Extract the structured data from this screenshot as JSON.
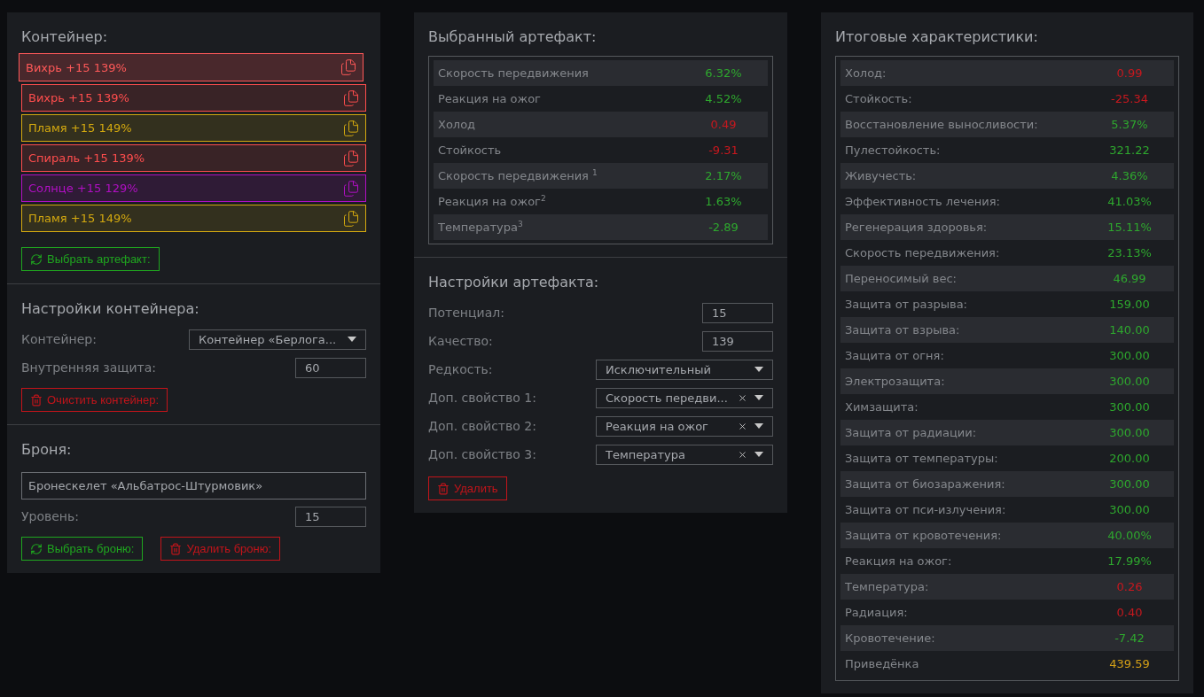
{
  "container": {
    "title": "Контейнер:",
    "slots": [
      {
        "label": "Вихрь +15 139%",
        "color": "#ff4d4d",
        "selected": true
      },
      {
        "label": "Вихрь +15 139%",
        "color": "#ff4d4d",
        "selected": false
      },
      {
        "label": "Пламя +15 149%",
        "color": "#d4a90f",
        "selected": false
      },
      {
        "label": "Спираль +15 139%",
        "color": "#ff4d4d",
        "selected": false
      },
      {
        "label": "Солнце +15 129%",
        "color": "#b10fc4",
        "selected": false
      },
      {
        "label": "Пламя +15 149%",
        "color": "#d4a90f",
        "selected": false
      }
    ],
    "buttons": [
      {
        "kind": "select",
        "label": "Выбрать артефакт:"
      }
    ]
  },
  "container_settings": {
    "title": "Настройки контейнера:",
    "fields": [
      {
        "kind": "select",
        "label": "Контейнер:",
        "value": "Контейнер «Берлога..."
      },
      {
        "kind": "input",
        "label": "Внутренняя защита:",
        "value": "60"
      }
    ],
    "buttons": [
      {
        "kind": "delete",
        "label": "Очистить контейнер:"
      }
    ]
  },
  "armor": {
    "title": "Броня:",
    "name": "Бронескелет «Альбатрос-Штурмовик»",
    "fields": [
      {
        "kind": "input",
        "label": "Уровень:",
        "value": "15"
      }
    ],
    "buttons": [
      {
        "kind": "select",
        "label": "Выбрать броню:"
      },
      {
        "kind": "delete",
        "label": "Удалить броню:"
      }
    ]
  },
  "selected_artifact": {
    "title": "Выбранный артефакт:",
    "stats": [
      {
        "name": "Скорость передвижения",
        "value": "6.32%",
        "color": "#2ea82e"
      },
      {
        "name": "Реакция на ожог",
        "value": "4.52%",
        "color": "#2ea82e"
      },
      {
        "name": "Холод",
        "value": "0.49",
        "color": "#c8181e"
      },
      {
        "name": "Стойкость",
        "value": "-9.31",
        "color": "#c8181e"
      },
      {
        "name": "Скорость передвижения $^{1}$",
        "value": "2.17%",
        "color": "#2ea82e"
      },
      {
        "name": "Реакция на ожог$^{2}$",
        "value": "1.63%",
        "color": "#2ea82e"
      },
      {
        "name": "Температура$^{3}$",
        "value": "-2.89",
        "color": "#2ea82e"
      }
    ]
  },
  "artifact_settings": {
    "title": "Настройки артефакта:",
    "fields": [
      {
        "kind": "input",
        "label": "Потенциал:",
        "value": "15"
      },
      {
        "kind": "input",
        "label": "Качество:",
        "value": "139"
      },
      {
        "kind": "select",
        "label": "Редкость:",
        "value": "Исключительный"
      },
      {
        "kind": "clearable",
        "label": "Доп. свойство 1:",
        "value": "Скорость передви..."
      },
      {
        "kind": "clearable",
        "label": "Доп. свойство 2:",
        "value": "Реакция на ожог"
      },
      {
        "kind": "clearable",
        "label": "Доп. свойство 3:",
        "value": "Температура"
      }
    ],
    "buttons": [
      {
        "kind": "delete",
        "label": "Удалить"
      }
    ]
  },
  "total_stats": {
    "title": "Итоговые характеристики:",
    "stats": [
      {
        "name": "Холод:",
        "value": "0.99",
        "color": "#c8181e"
      },
      {
        "name": "Стойкость:",
        "value": "-25.34",
        "color": "#c8181e"
      },
      {
        "name": "Восстановление выносливости:",
        "value": "5.37%",
        "color": "#2ea82e"
      },
      {
        "name": "Пулестойкость:",
        "value": "321.22",
        "color": "#2ea82e"
      },
      {
        "name": "Живучесть:",
        "value": "4.36%",
        "color": "#2ea82e"
      },
      {
        "name": "Эффективность лечения:",
        "value": "41.03%",
        "color": "#2ea82e"
      },
      {
        "name": "Регенерация здоровья:",
        "value": "15.11%",
        "color": "#2ea82e"
      },
      {
        "name": "Скорость передвижения:",
        "value": "23.13%",
        "color": "#2ea82e"
      },
      {
        "name": "Переносимый вес:",
        "value": "46.99",
        "color": "#2ea82e"
      },
      {
        "name": "Защита от разрыва:",
        "value": "159.00",
        "color": "#2ea82e"
      },
      {
        "name": "Защита от взрыва:",
        "value": "140.00",
        "color": "#2ea82e"
      },
      {
        "name": "Защита от огня:",
        "value": "300.00",
        "color": "#2ea82e"
      },
      {
        "name": "Электрозащита:",
        "value": "300.00",
        "color": "#2ea82e"
      },
      {
        "name": "Химзащита:",
        "value": "300.00",
        "color": "#2ea82e"
      },
      {
        "name": "Защита от радиации:",
        "value": "300.00",
        "color": "#2ea82e"
      },
      {
        "name": "Защита от температуры:",
        "value": "200.00",
        "color": "#2ea82e"
      },
      {
        "name": "Защита от биозаражения:",
        "value": "300.00",
        "color": "#2ea82e"
      },
      {
        "name": "Защита от пси-излучения:",
        "value": "300.00",
        "color": "#2ea82e"
      },
      {
        "name": "Защита от кровотечения:",
        "value": "40.00%",
        "color": "#2ea82e"
      },
      {
        "name": "Реакция на ожог:",
        "value": "17.99%",
        "color": "#2ea82e"
      },
      {
        "name": "Температура:",
        "value": "0.26",
        "color": "#c8181e"
      },
      {
        "name": "Радиация:",
        "value": "0.40",
        "color": "#c8181e"
      },
      {
        "name": "Кровотечение:",
        "value": "-7.42",
        "color": "#2ea82e"
      },
      {
        "name": "Приведёнка",
        "value": "439.59",
        "color": "#d4a017"
      }
    ]
  }
}
